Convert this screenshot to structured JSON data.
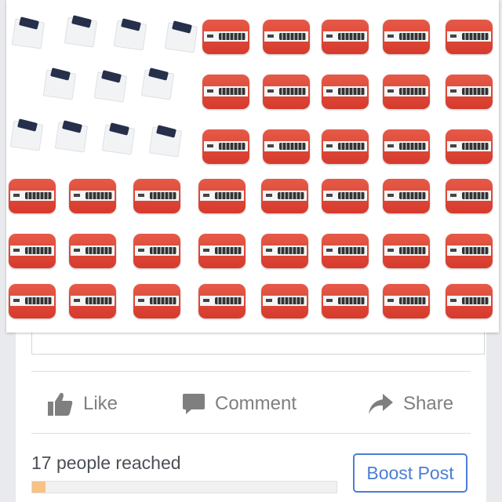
{
  "photo": {
    "alt_icon": "flag-product-collage"
  },
  "actions": {
    "like": {
      "label": "Like",
      "icon": "thumbs-up-icon"
    },
    "comment": {
      "label": "Comment",
      "icon": "comment-icon"
    },
    "share": {
      "label": "Share",
      "icon": "share-icon"
    }
  },
  "insights": {
    "reach_text": "17 people reached",
    "progress_fraction": 0.045
  },
  "boost": {
    "label": "Boost Post"
  },
  "colors": {
    "accent": "#4b7dd6",
    "action_gray": "#7f7f7f",
    "progress_fill": "#f8c283",
    "tile_red": "#e04a3a"
  }
}
